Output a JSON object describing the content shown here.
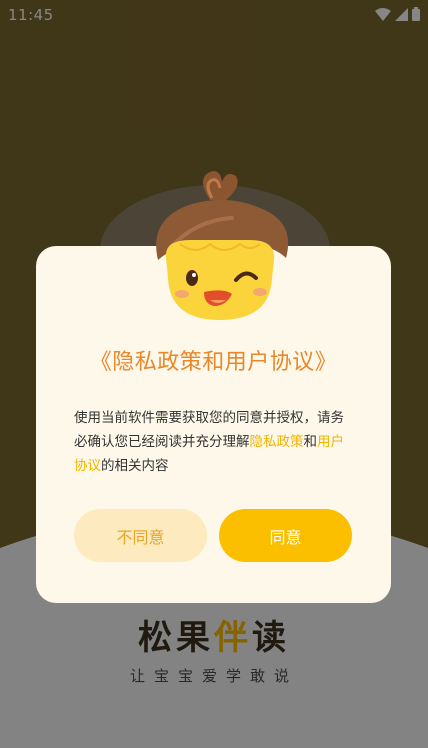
{
  "status_bar": {
    "time": "11:45",
    "icons": [
      "wifi-icon",
      "cell-signal-icon",
      "battery-icon"
    ]
  },
  "brand": {
    "title_part1": "松果",
    "title_part2": "伴",
    "title_part3": "读",
    "subtitle": "让宝宝爱学敢说"
  },
  "dialog": {
    "title": "《隐私政策和用户协议》",
    "body_prefix": "使用当前软件需要获取您的同意并授权，请务必确认您已经阅读并充分理解",
    "privacy_link": "隐私政策",
    "body_and": "和",
    "user_agreement_link": "用户协议",
    "body_suffix": "的相关内容",
    "disagree_label": "不同意",
    "agree_label": "同意"
  },
  "colors": {
    "accent": "#fcbf00",
    "link": "#f2b400",
    "title": "#e8882b",
    "dialog_bg": "#fdf8e9"
  }
}
